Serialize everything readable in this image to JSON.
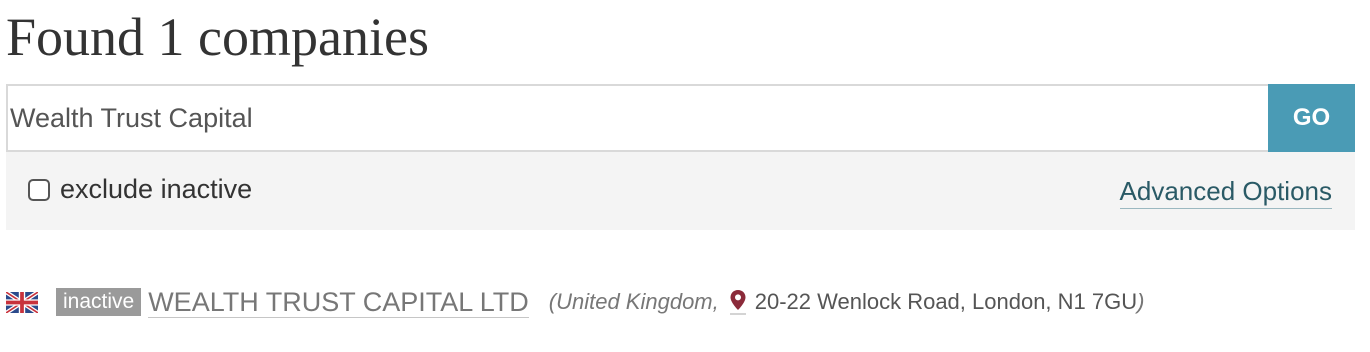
{
  "header": {
    "title": "Found 1 companies"
  },
  "search": {
    "query": "Wealth Trust Capital",
    "go_label": "GO",
    "exclude_inactive_label": "exclude inactive",
    "exclude_inactive_checked": false,
    "advanced_options_label": "Advanced Options"
  },
  "results": [
    {
      "flag_icon": "uk-flag-icon",
      "status": "inactive",
      "name": "WEALTH TRUST CAPITAL LTD",
      "open_paren": "(",
      "country": "United Kingdom,",
      "location_icon": "map-pin-icon",
      "address": "20-22 Wenlock Road, London, N1 7GU",
      "close_paren": ")"
    }
  ],
  "colors": {
    "go_button": "#4a9bb5",
    "status_badge": "#9a9a9a",
    "pin": "#8b2a3a",
    "link": "#2a5a66"
  }
}
